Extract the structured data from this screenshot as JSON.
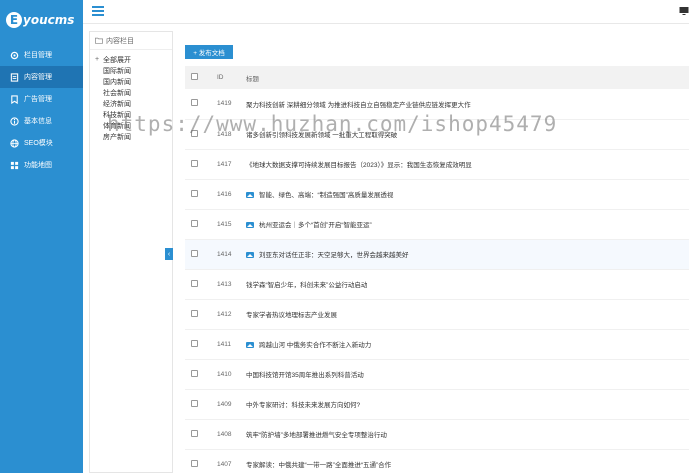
{
  "brand": {
    "logo_letter": "E",
    "logo_text": "youcms"
  },
  "sidebar": {
    "items": [
      {
        "label": "栏目管理",
        "icon": "gear-icon"
      },
      {
        "label": "内容管理",
        "icon": "document-icon",
        "active": true
      },
      {
        "label": "广告管理",
        "icon": "bookmark-icon"
      },
      {
        "label": "基本信息",
        "icon": "info-icon"
      },
      {
        "label": "SEO模块",
        "icon": "globe-icon"
      },
      {
        "label": "功能地图",
        "icon": "grid-icon"
      }
    ]
  },
  "tree": {
    "header": "内容栏目",
    "root": {
      "toggle": "+",
      "label": "全部展开"
    },
    "children": [
      "国际新闻",
      "国内新闻",
      "社会新闻",
      "经济新闻",
      "科技新闻",
      "体育新闻",
      "房产新闻"
    ]
  },
  "toolbar": {
    "add_label": "+ 发布文档"
  },
  "table": {
    "headers": {
      "id": "ID",
      "title": "标题"
    },
    "rows": [
      {
        "id": "1419",
        "title": "聚力科技创新 深耕细分领域 为推进科技自立自强稳定产业链供应链发挥更大作",
        "image": false
      },
      {
        "id": "1418",
        "title": "诸多创新引领科技发展新领域 一批重大工程取得突破",
        "image": false
      },
      {
        "id": "1417",
        "title": "《地球大数据支撑可持续发展目标报告（2023）》显示：我国生态恢复成效明显",
        "image": false
      },
      {
        "id": "1416",
        "title": "智能、绿色、高端：“制造强国”高质量发展透视",
        "image": true
      },
      {
        "id": "1415",
        "title": "杭州亚运会｜多个“首创”开启“智能亚运”",
        "image": true
      },
      {
        "id": "1414",
        "title": "刘亚东对话任正非：天空足够大，世界会越来越美好",
        "image": true
      },
      {
        "id": "1413",
        "title": "钱学森“智启少年，科创未来”公益行动启动",
        "image": false
      },
      {
        "id": "1412",
        "title": "专家学者热议地理标志产业发展",
        "image": false
      },
      {
        "id": "1411",
        "title": "跨越山河 中俄务实合作不断注入新动力",
        "image": true
      },
      {
        "id": "1410",
        "title": "中国科技馆开馆35周年推出系列科普活动",
        "image": false
      },
      {
        "id": "1409",
        "title": "中外专家研讨：科技未来发展方向如何?",
        "image": false
      },
      {
        "id": "1408",
        "title": "筑牢“防护墙”多地部署推进燃气安全专项整治行动",
        "image": false
      },
      {
        "id": "1407",
        "title": "专家解读：中俄共建“一带一路”全面推进“五通”合作",
        "image": false
      }
    ]
  },
  "watermark": "https://www.huzhan.com/ishop45479",
  "colors": {
    "accent": "#2b8fd1",
    "sidebar_active": "#1f74b3"
  }
}
